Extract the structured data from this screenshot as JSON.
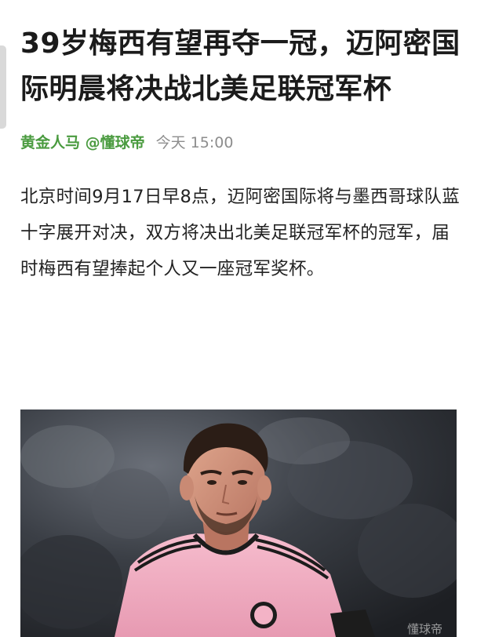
{
  "article": {
    "headline": "39岁梅西有望再夺一冠，迈阿密国际明晨将决战北美足联冠军杯",
    "author": "黄金人马 @懂球帝",
    "time": "今天 15:00",
    "body": "北京时间9月17日早8点，迈阿密国际将与墨西哥球队蓝十字展开对决，双方将决出北美足联冠军杯的冠军，届时梅西有望捧起个人又一座冠军奖杯。"
  },
  "photo": {
    "watermark": "懂球帝"
  },
  "colors": {
    "author_green": "#4a9b3f",
    "meta_gray": "#8d8d8d",
    "jersey_pink": "#f3b3c6"
  }
}
